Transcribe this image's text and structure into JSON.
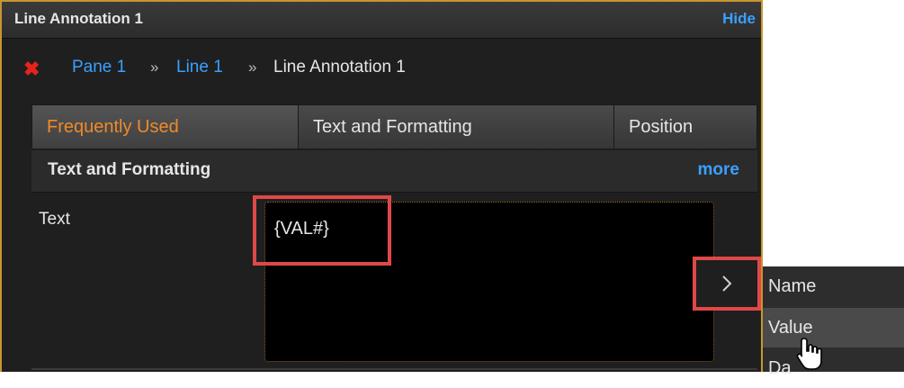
{
  "panel": {
    "title": "Line Annotation 1",
    "hide_label": "Hide",
    "border_color": "#c8962e"
  },
  "breadcrumb": {
    "items": [
      "Pane 1",
      "Line 1"
    ],
    "separator": "»",
    "current": "Line Annotation 1"
  },
  "tabs": [
    {
      "label": "Frequently Used",
      "active": true
    },
    {
      "label": "Text and Formatting",
      "active": false
    },
    {
      "label": "Position",
      "active": false
    }
  ],
  "section": {
    "title": "Text and Formatting",
    "more_label": "more"
  },
  "text_field": {
    "label": "Text",
    "value": "{VAL#}"
  },
  "menu": {
    "items": [
      {
        "label": "Name"
      },
      {
        "label": "Value"
      },
      {
        "label": "Da"
      }
    ],
    "hovered": "Value"
  },
  "colors": {
    "accent_orange": "#f08a2a",
    "link_blue": "#3aa0ff",
    "close_red": "#e8231c",
    "highlight_red": "#e04848"
  },
  "icons": {
    "close": "close-icon",
    "insert_arrow": "chevron-right-icon",
    "cursor": "hand-pointer-icon"
  }
}
